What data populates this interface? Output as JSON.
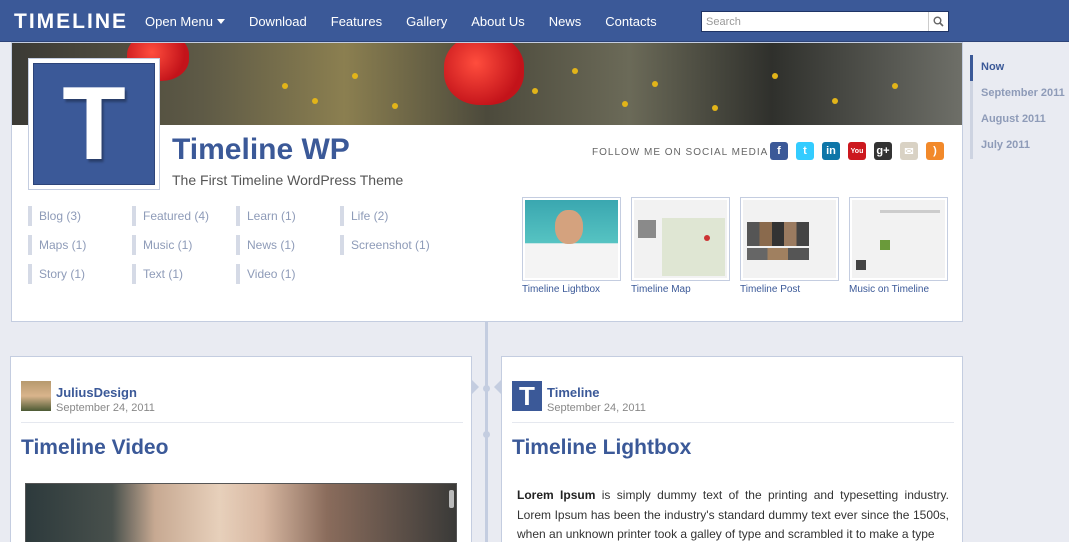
{
  "app": {
    "logo": "TIMELINE"
  },
  "nav": {
    "items": [
      {
        "label": "Open Menu",
        "dropdown": true
      },
      {
        "label": "Download"
      },
      {
        "label": "Features"
      },
      {
        "label": "Gallery"
      },
      {
        "label": "About Us"
      },
      {
        "label": "News"
      },
      {
        "label": "Contacts"
      }
    ],
    "search_placeholder": "Search"
  },
  "dates": [
    "Now",
    "September 2011",
    "August 2011",
    "July 2011"
  ],
  "header": {
    "avatar_letter": "T",
    "title": "Timeline WP",
    "subtitle": "The First Timeline WordPress Theme",
    "follow_label": "FOLLOW ME ON SOCIAL MEDIA",
    "socials": [
      {
        "name": "facebook-icon",
        "glyph": "f",
        "color": "#3b5998"
      },
      {
        "name": "twitter-icon",
        "glyph": "t",
        "color": "#33ccff"
      },
      {
        "name": "linkedin-icon",
        "glyph": "in",
        "color": "#0e76a8"
      },
      {
        "name": "youtube-icon",
        "glyph": "You",
        "color": "#cc181e"
      },
      {
        "name": "google-plus-icon",
        "glyph": "g+",
        "color": "#333333"
      },
      {
        "name": "email-icon",
        "glyph": "✉",
        "color": "#d9d2c4"
      },
      {
        "name": "rss-icon",
        "glyph": ")",
        "color": "#f2892a"
      }
    ],
    "categories": [
      "Blog (3)",
      "Featured (4)",
      "Learn (1)",
      "Life (2)",
      "Maps (1)",
      "Music (1)",
      "News (1)",
      "Screenshot (1)",
      "Story (1)",
      "Text (1)",
      "Video (1)"
    ],
    "thumbnails": [
      {
        "caption": "Timeline Lightbox"
      },
      {
        "caption": "Timeline Map"
      },
      {
        "caption": "Timeline Post"
      },
      {
        "caption": "Music on Timeline"
      }
    ]
  },
  "posts": {
    "left": {
      "author": "JuliusDesign",
      "date": "September 24, 2011",
      "title": "Timeline Video"
    },
    "right": {
      "author": "Timeline",
      "avatar_letter": "T",
      "date": "September 24, 2011",
      "title": "Timeline Lightbox",
      "text_bold": "Lorem Ipsum",
      "text": " is simply dummy text of the printing and typesetting industry. Lorem Ipsum has been the industry's standard dummy text ever since the 1500s, when an unknown printer took a galley of type and scrambled it to make a type"
    }
  },
  "colors": {
    "brand": "#3b5998",
    "background": "#e9ebf2"
  }
}
